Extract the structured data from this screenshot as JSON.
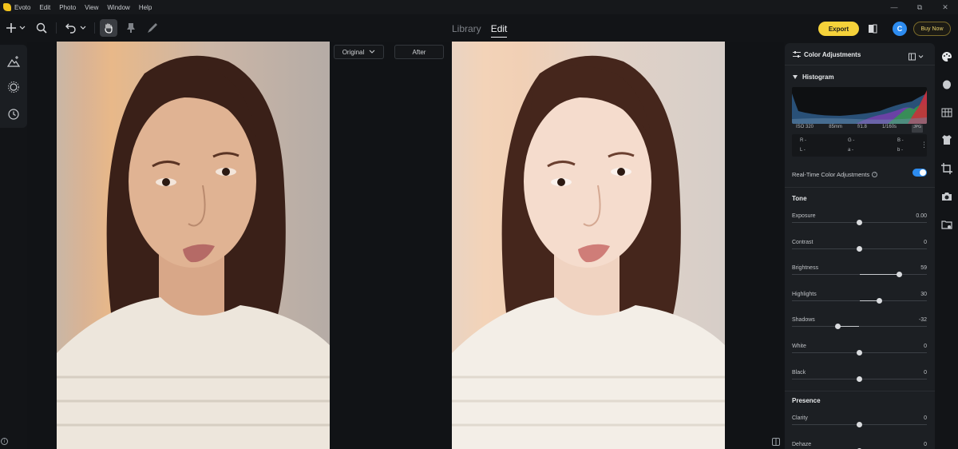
{
  "app": {
    "name": "Evoto",
    "menus": [
      "Edit",
      "Photo",
      "View",
      "Window",
      "Help"
    ]
  },
  "toolbar": {
    "view_tabs": [
      {
        "label": "Library",
        "active": false
      },
      {
        "label": "Edit",
        "active": true
      }
    ],
    "export_label": "Export",
    "avatar_initial": "C",
    "buy_now_label": "Buy Now",
    "tools": [
      "add-icon",
      "search-icon",
      "undo-icon",
      "hand-icon",
      "stamp-icon",
      "brush-icon"
    ]
  },
  "canvas": {
    "original_label": "Original",
    "after_label": "After"
  },
  "panel": {
    "title": "Color Adjustments",
    "histogram_title": "Histogram",
    "exif": {
      "iso": "ISO 320",
      "focal": "85mm",
      "aperture": "f/1.8",
      "shutter": "1/160s",
      "format": "JPG"
    },
    "pixel_info": {
      "r": "R -",
      "g": "G -",
      "b": "B -",
      "l": "L -",
      "a": "a -",
      "b2": "b -"
    },
    "realtime_label": "Real-Time Color Adjustments",
    "realtime_enabled": true,
    "tone_title": "Tone",
    "presence_title": "Presence",
    "tone_sliders": [
      {
        "label": "Exposure",
        "value": "0.00",
        "position": 0.5
      },
      {
        "label": "Contrast",
        "value": "0",
        "position": 0.5
      },
      {
        "label": "Brightness",
        "value": "59",
        "position": 0.795
      },
      {
        "label": "Highlights",
        "value": "30",
        "position": 0.65
      },
      {
        "label": "Shadows",
        "value": "-32",
        "position": 0.34
      },
      {
        "label": "White",
        "value": "0",
        "position": 0.5
      },
      {
        "label": "Black",
        "value": "0",
        "position": 0.5
      }
    ],
    "presence_sliders": [
      {
        "label": "Clarity",
        "value": "0",
        "position": 0.5
      },
      {
        "label": "Dehaze",
        "value": "0",
        "position": 0.5
      }
    ]
  },
  "colors": {
    "accent_yellow": "#f5d23a",
    "accent_blue": "#2d8cf0",
    "panel_bg": "#1c1f23"
  }
}
